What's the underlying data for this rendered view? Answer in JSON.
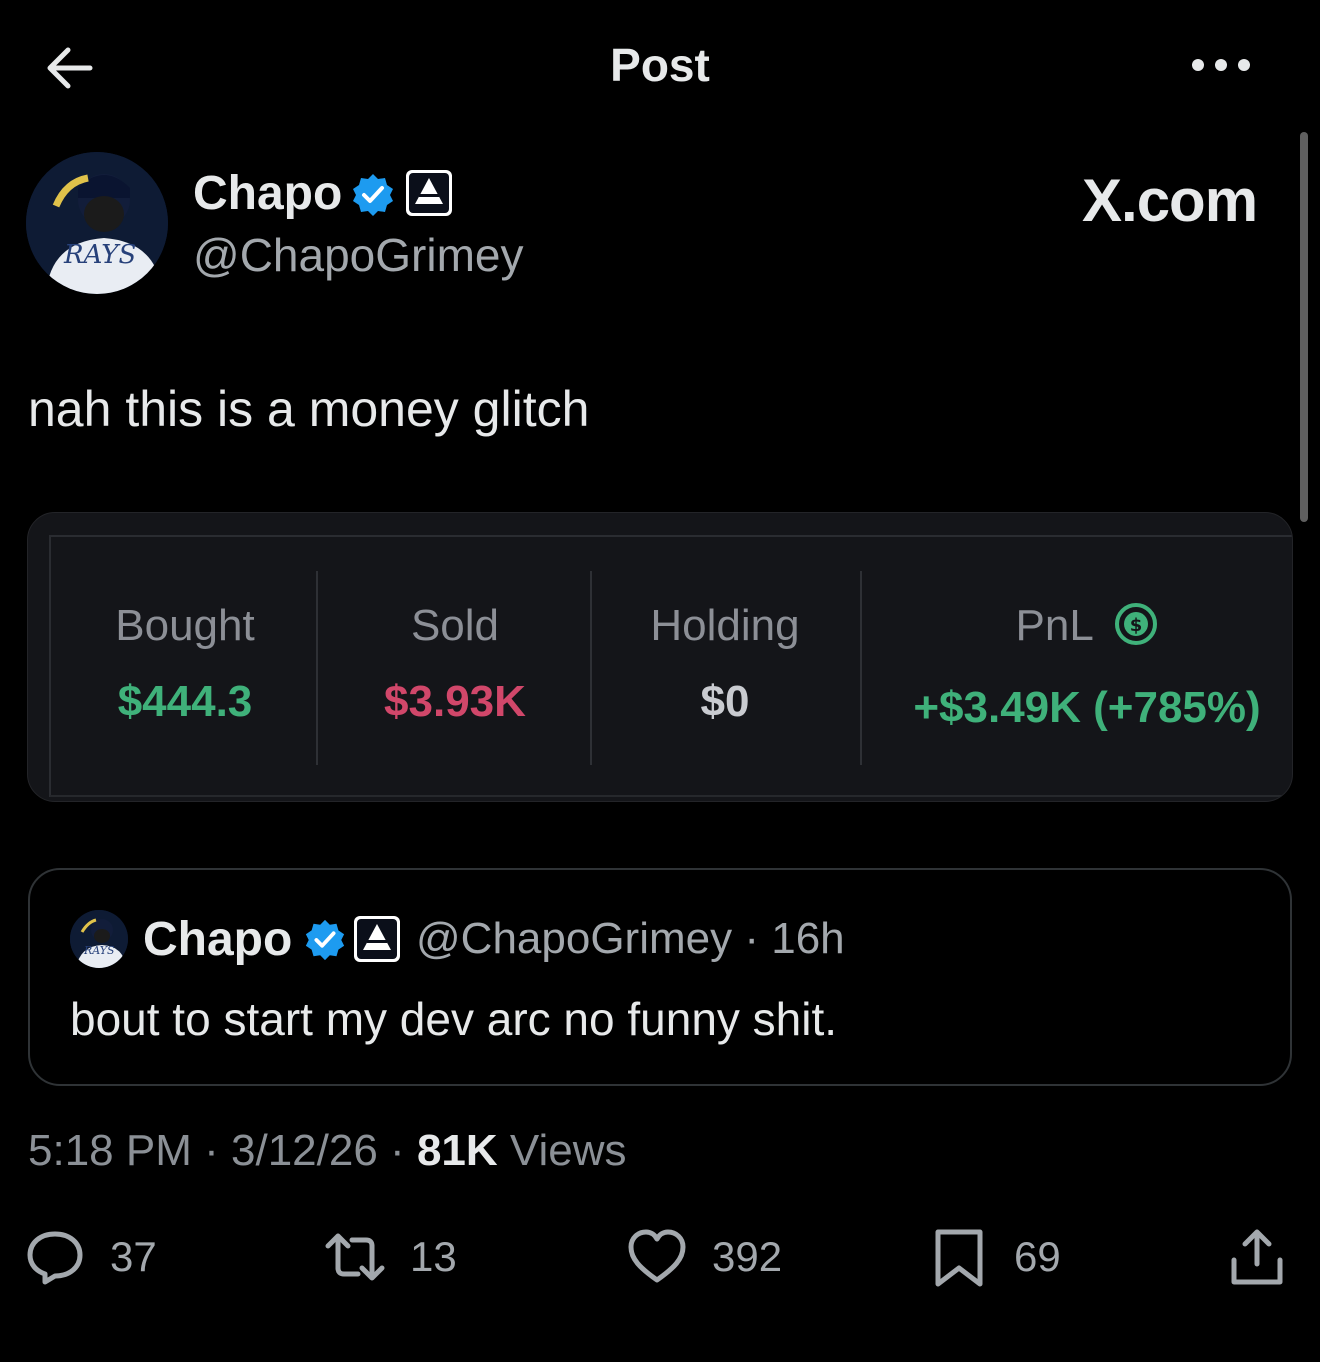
{
  "header": {
    "title": "Post"
  },
  "author": {
    "display_name": "Chapo",
    "handle": "@ChapoGrimey",
    "avatar_text": "RAYS"
  },
  "watermark": "X.com",
  "post": {
    "text": "nah this is a money glitch"
  },
  "stats": {
    "columns": [
      {
        "label": "Bought",
        "value": "$444.3",
        "color": "#3fb17a"
      },
      {
        "label": "Sold",
        "value": "$3.93K",
        "color": "#d1476a"
      },
      {
        "label": "Holding",
        "value": "$0",
        "color": "#c9cbd0"
      },
      {
        "label": "PnL",
        "value": "+$3.49K (+785%)",
        "color": "#3fb17a"
      }
    ],
    "pnl_icon": "dollar-circle-icon"
  },
  "quote": {
    "display_name": "Chapo",
    "handle": "@ChapoGrimey",
    "separator": "·",
    "time": "16h",
    "text": "bout to start my dev arc no funny shit.",
    "avatar_text": "RAYS"
  },
  "meta": {
    "time": "5:18 PM",
    "date": "3/12/26",
    "separator": "·",
    "views_count": "81K",
    "views_label": "Views"
  },
  "actions": {
    "replies": "37",
    "reposts": "13",
    "likes": "392",
    "bookmarks": "69"
  },
  "colors": {
    "verified_blue": "#1d9bf0",
    "green": "#3fb17a",
    "red": "#d1476a"
  }
}
